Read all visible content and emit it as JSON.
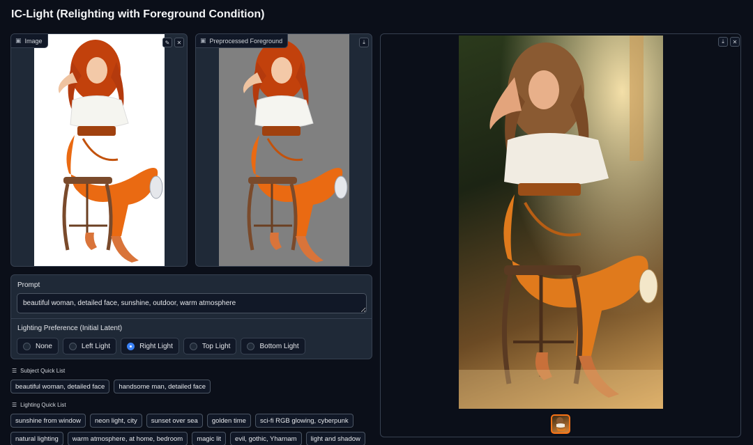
{
  "app": {
    "title": "IC-Light (Relighting with Foreground Condition)"
  },
  "input_image": {
    "label": "Image",
    "label_icon": "image-icon",
    "edit_icon": "pencil-icon",
    "close_icon": "close-icon"
  },
  "preprocessed": {
    "label": "Preprocessed Foreground",
    "label_icon": "image-icon",
    "download_icon": "download-icon"
  },
  "output": {
    "download_icon": "download-icon",
    "close_icon": "close-icon"
  },
  "prompt": {
    "label": "Prompt",
    "value": "beautiful woman, detailed face, sunshine, outdoor, warm atmosphere"
  },
  "lighting": {
    "label": "Lighting Preference (Initial Latent)",
    "options": [
      "None",
      "Left Light",
      "Right Light",
      "Top Light",
      "Bottom Light"
    ],
    "selected": "Right Light"
  },
  "subject_quick_list": {
    "label": "Subject Quick List",
    "items": [
      "beautiful woman, detailed face",
      "handsome man, detailed face"
    ]
  },
  "lighting_quick_list": {
    "label": "Lighting Quick List",
    "row1": [
      "sunshine from window",
      "neon light, city",
      "sunset over sea",
      "golden time",
      "sci-fi RGB glowing, cyberpunk"
    ],
    "row2": [
      "natural lighting",
      "warm atmosphere, at home, bedroom",
      "magic lit",
      "evil, gothic, Yharnam",
      "light and shadow"
    ]
  },
  "colors": {
    "background": "#0b0f19",
    "panel": "#1f2937",
    "accent": "#3b82f6",
    "thumb_border": "#f97316"
  }
}
